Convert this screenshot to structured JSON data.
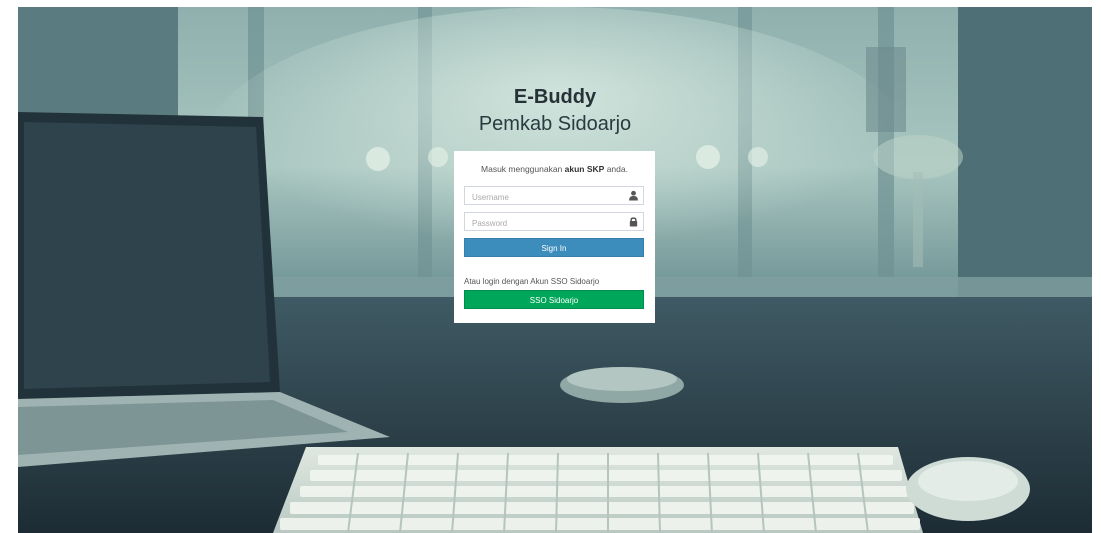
{
  "brand": {
    "title": "E-Buddy",
    "subtitle": "Pemkab Sidoarjo"
  },
  "login": {
    "message_prefix": "Masuk menggunakan ",
    "message_bold": "akun SKP",
    "message_suffix": " anda.",
    "username": {
      "value": "",
      "placeholder": "Username",
      "icon": "user-icon"
    },
    "password": {
      "value": "",
      "placeholder": "Password",
      "icon": "lock-icon"
    },
    "signin_label": "Sign In",
    "alt_text": "Atau login dengan Akun SSO Sidoarjo",
    "sso_label": "SSO Sidoarjo"
  },
  "colors": {
    "signin": "#3c8dbc",
    "sso": "#00a65a",
    "background": "#5b7f86"
  }
}
